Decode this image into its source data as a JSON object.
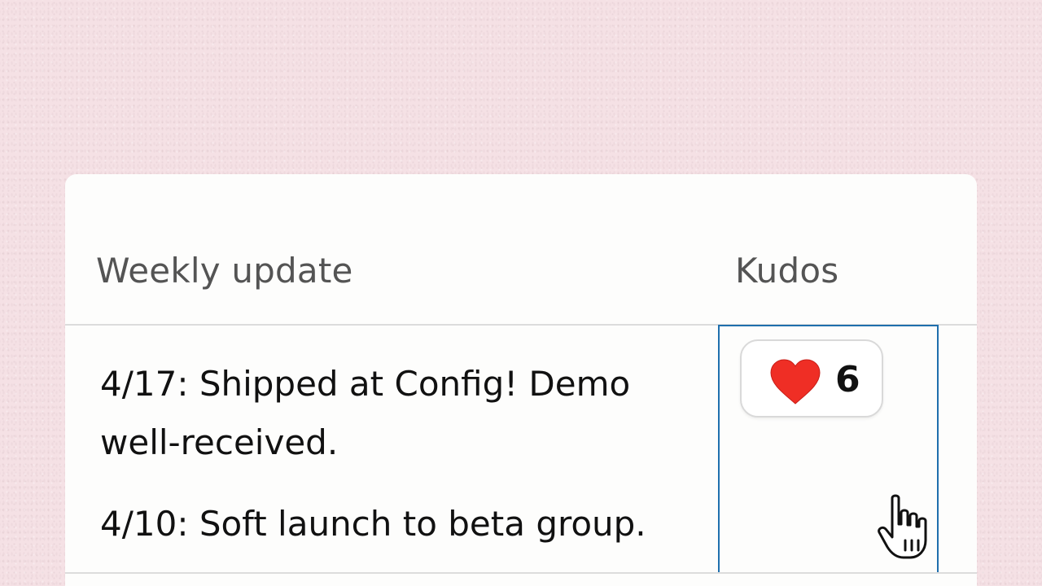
{
  "table": {
    "headers": {
      "update": "Weekly update",
      "kudos": "Kudos"
    },
    "rows": [
      {
        "updates": [
          "4/17: Shipped at Config! Demo well-received.",
          "4/10: Soft launch to beta group."
        ],
        "kudos": {
          "icon": "heart-icon",
          "count": "6"
        }
      }
    ]
  },
  "cursor": {
    "icon": "hand-pointer-icon"
  },
  "colors": {
    "background": "#f5e1e5",
    "card": "#fdfdfc",
    "cell_highlight": "#1f6fad",
    "heart": "#ef2e25"
  }
}
